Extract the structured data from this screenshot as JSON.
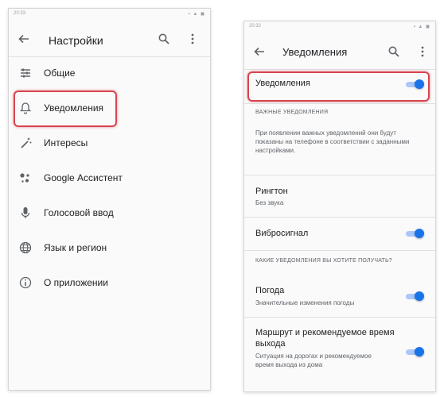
{
  "left_screen": {
    "status_time": "20:33",
    "status_icons": "▪ ▲ ◼",
    "title": "Настройки",
    "menu": [
      {
        "label": "Общие",
        "icon": "sliders-icon"
      },
      {
        "label": "Уведомления",
        "icon": "bell-icon"
      },
      {
        "label": "Интересы",
        "icon": "magic-wand-icon"
      },
      {
        "label": "Google Ассистент",
        "icon": "assistant-icon"
      },
      {
        "label": "Голосовой ввод",
        "icon": "microphone-icon"
      },
      {
        "label": "Язык и регион",
        "icon": "globe-icon"
      },
      {
        "label": "О приложении",
        "icon": "info-icon"
      }
    ]
  },
  "right_screen": {
    "status_time": "20:32",
    "status_icons": "▪ ▲ ◼",
    "title": "Уведомления",
    "master_toggle": {
      "label": "Уведомления",
      "on": true
    },
    "section_important": "ВАЖНЫЕ УВЕДОМЛЕНИЯ",
    "important_desc": "При появлении важных уведомлений они будут показаны на телефоне в соответствии с заданными настройками.",
    "ringtone": {
      "title": "Рингтон",
      "value": "Без звука"
    },
    "vibration": {
      "label": "Виброcигнал",
      "on": true
    },
    "section_which": "КАКИЕ УВЕДОМЛЕНИЯ ВЫ ХОТИТЕ ПОЛУЧАТЬ?",
    "weather": {
      "title": "Погода",
      "subtitle": "Значительные изменения погоды",
      "on": true
    },
    "route": {
      "title": "Маршрут и рекомендуемое время выхода",
      "subtitle": "Ситуация на дорогах и рекомендуемое время выхода из дома",
      "on": true
    }
  },
  "colors": {
    "accent": "#1a73e8",
    "highlight": "#d64550"
  }
}
